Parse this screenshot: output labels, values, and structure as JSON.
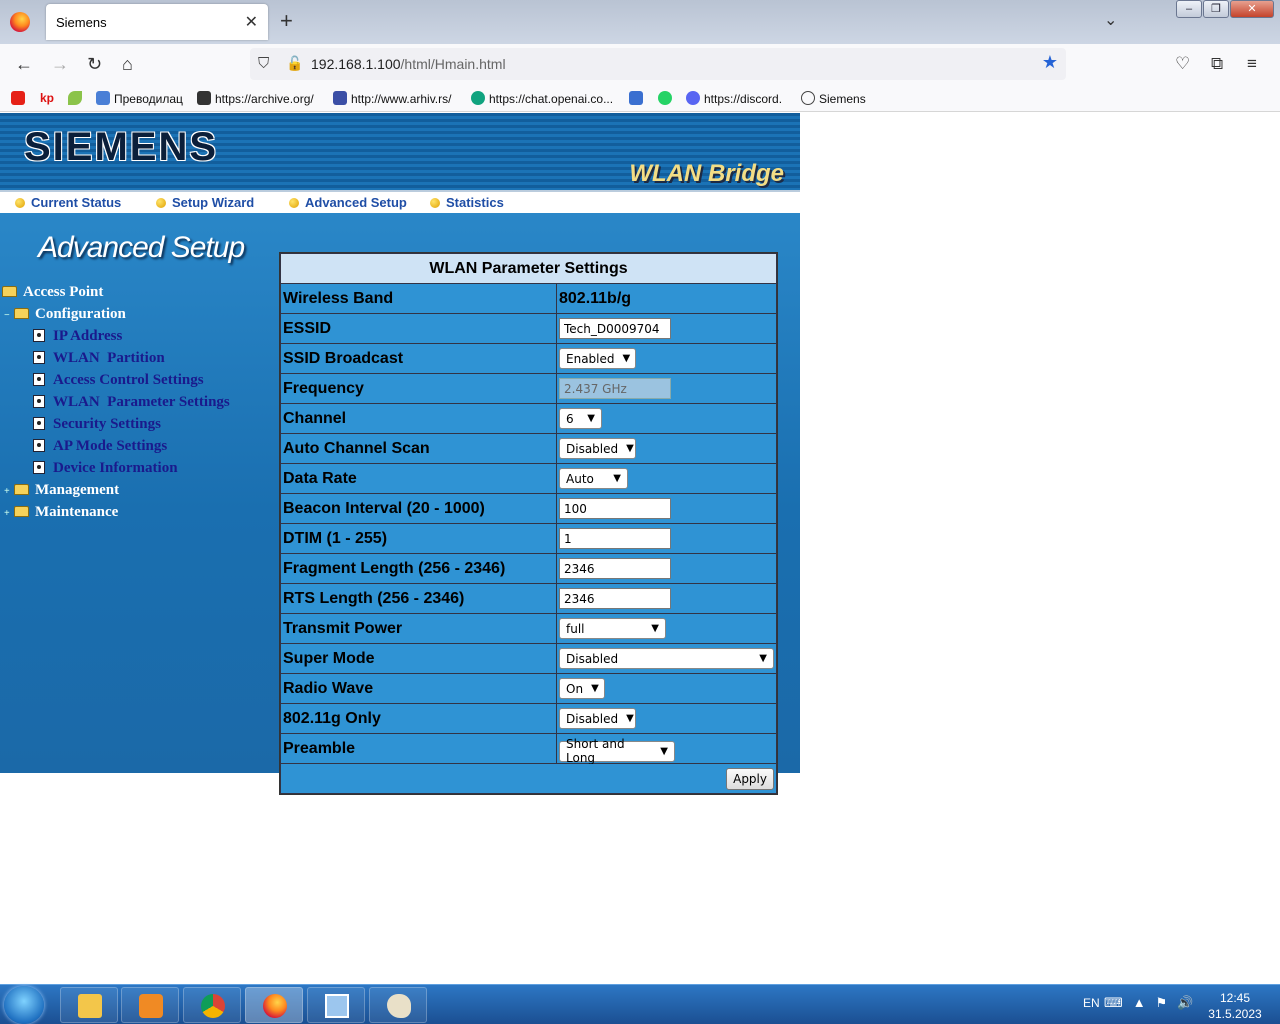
{
  "browser": {
    "tab_title": "Siemens",
    "url_host": "192.168.1.100",
    "url_path": "/html/Hmain.html",
    "bookmarks": [
      {
        "label": "",
        "icon": "youtube-icon",
        "color": "#e62117"
      },
      {
        "label": "kp",
        "icon": "kp-icon",
        "color": "#d11"
      },
      {
        "label": "",
        "icon": "leaf-icon",
        "color": "#8bc34a"
      },
      {
        "label": "Преводилац",
        "icon": "translate-icon",
        "color": "#4a7fd6"
      },
      {
        "label": "https://archive.org/",
        "icon": "archive-icon",
        "color": "#333"
      },
      {
        "label": "http://www.arhiv.rs/",
        "icon": "arhiv-icon",
        "color": "#3b4fa6"
      },
      {
        "label": "https://chat.openai.co...",
        "icon": "openai-icon",
        "color": "#10a37f"
      },
      {
        "label": "",
        "icon": "s-icon",
        "color": "#3a6fd0"
      },
      {
        "label": "",
        "icon": "whatsapp-icon",
        "color": "#25d366"
      },
      {
        "label": "https://discord.",
        "icon": "discord-icon",
        "color": "#5865f2"
      },
      {
        "label": "Siemens",
        "icon": "globe-icon",
        "color": "#444"
      }
    ]
  },
  "router": {
    "brand": "SIEMENS",
    "product": "WLAN Bridge",
    "menu": [
      "Current Status",
      "Setup Wizard",
      "Advanced Setup",
      "Statistics"
    ],
    "section_title": "Advanced Setup",
    "tree": {
      "root": "Access Point",
      "configuration": "Configuration",
      "items": [
        "IP Address",
        "WLAN  Partition",
        "Access Control Settings",
        "WLAN  Parameter Settings",
        "Security Settings",
        "AP Mode Settings",
        "Device Information"
      ],
      "management": "Management",
      "maintenance": "Maintenance"
    },
    "table": {
      "title": "WLAN Parameter Settings",
      "rows": [
        {
          "label": "Wireless Band",
          "value": "802.11b/g"
        },
        {
          "label": "ESSID",
          "value": "Tech_D0009704"
        },
        {
          "label": "SSID Broadcast",
          "value": "Enabled"
        },
        {
          "label": "Frequency",
          "value": "2.437 GHz"
        },
        {
          "label": "Channel",
          "value": "6"
        },
        {
          "label": "Auto Channel Scan",
          "value": "Disabled"
        },
        {
          "label": "Data Rate",
          "value": "Auto"
        },
        {
          "label": "Beacon Interval (20 - 1000)",
          "value": "100"
        },
        {
          "label": "DTIM (1 - 255)",
          "value": "1"
        },
        {
          "label": "Fragment Length (256 - 2346)",
          "value": "2346"
        },
        {
          "label": "RTS Length (256 - 2346)",
          "value": "2346"
        },
        {
          "label": "Transmit Power",
          "value": "full"
        },
        {
          "label": "Super Mode",
          "value": "Disabled"
        },
        {
          "label": "Radio Wave",
          "value": "On"
        },
        {
          "label": "802.11g Only",
          "value": "Disabled"
        },
        {
          "label": "Preamble",
          "value": "Short and Long"
        }
      ],
      "apply_label": "Apply"
    }
  },
  "taskbar": {
    "language": "EN",
    "time": "12:45",
    "date": "31.5.2023"
  }
}
